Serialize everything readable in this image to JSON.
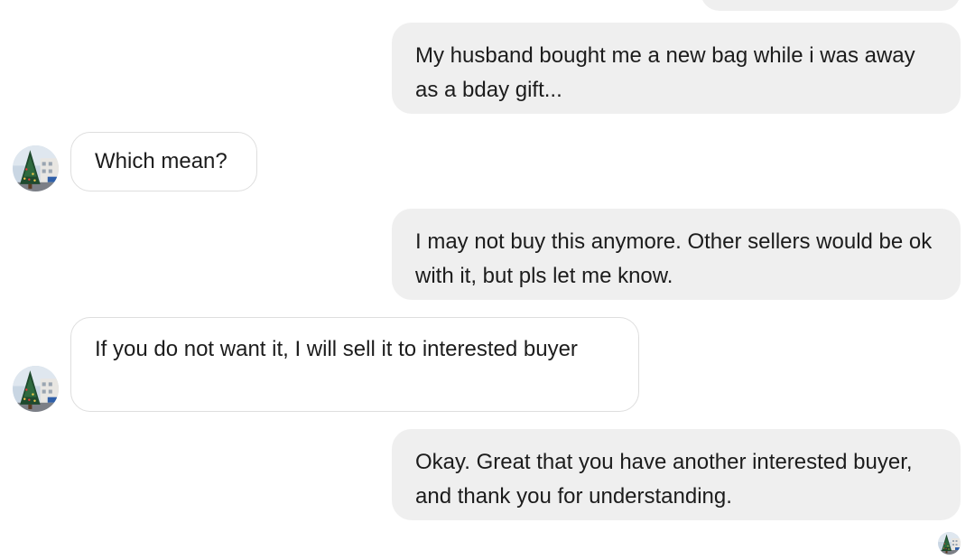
{
  "conversation": {
    "messages": [
      {
        "direction": "outgoing",
        "text": ""
      },
      {
        "direction": "outgoing",
        "text": "My husband bought me a new bag while i was away as a bday gift..."
      },
      {
        "direction": "incoming",
        "text": "Which mean?"
      },
      {
        "direction": "outgoing",
        "text": "I may not buy this anymore. Other sellers would be ok with it, but pls let me know."
      },
      {
        "direction": "incoming",
        "text": "If you do not want it, I will sell it to interested buyer"
      },
      {
        "direction": "outgoing",
        "text": "Okay. Great that you have another interested buyer, and thank you for understanding."
      }
    ],
    "avatar_icon": "christmas-tree-photo-icon",
    "read_receipt_icon": "seen-avatar-icon"
  },
  "colors": {
    "outgoing_bubble": "#efefef",
    "incoming_bubble": "#ffffff",
    "incoming_border": "#dedede",
    "text": "#1c1c1c"
  }
}
